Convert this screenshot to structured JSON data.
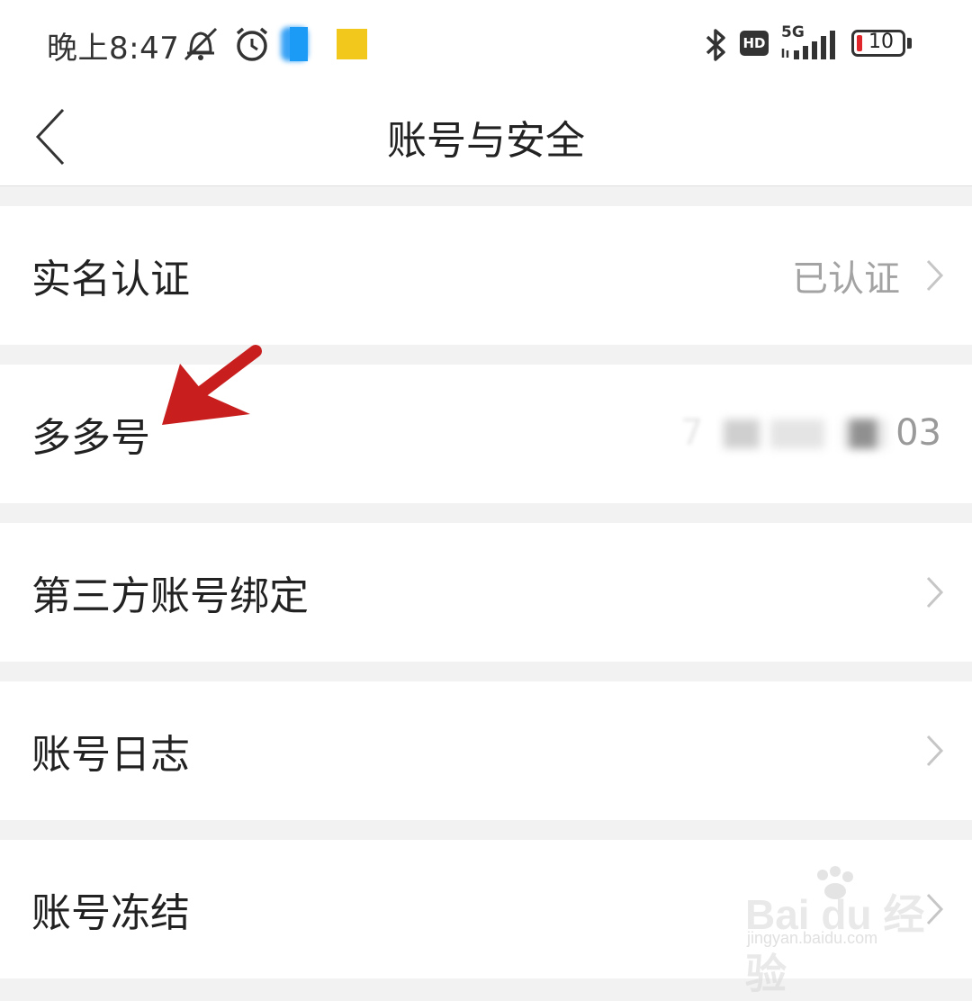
{
  "status_bar": {
    "time": "晚上8:47",
    "icons": [
      "mute-bell-icon",
      "alarm-icon",
      "app-notification-blue",
      "app-notification-yellow",
      "bluetooth-icon",
      "hd-icon",
      "signal-5g-icon",
      "battery-icon"
    ],
    "hd_label": "HD",
    "network": "5G",
    "battery_percent": "10",
    "battery_color": "#e0262b"
  },
  "header": {
    "back_icon": "chevron-left-icon",
    "title": "账号与安全"
  },
  "items": [
    {
      "label": "实名认证",
      "value": "已认证",
      "has_arrow": true
    },
    {
      "label": "多多号",
      "value_visible_start": "7",
      "value_visible_end": "03",
      "value_masked": true,
      "has_arrow": false
    },
    {
      "label": "第三方账号绑定",
      "value": "",
      "has_arrow": true
    },
    {
      "label": "账号日志",
      "value": "",
      "has_arrow": true
    },
    {
      "label": "账号冻结",
      "value": "",
      "has_arrow": true
    }
  ],
  "annotation": {
    "type": "red-arrow",
    "color": "#c81e1e",
    "points_to": "多多号"
  },
  "watermark": {
    "text": "Bai du 经验",
    "sub": "jingyan.baidu.com"
  },
  "colors": {
    "background": "#f2f2f2",
    "card": "#ffffff",
    "primary_text": "#222222",
    "secondary_text": "#a3a3a3"
  }
}
